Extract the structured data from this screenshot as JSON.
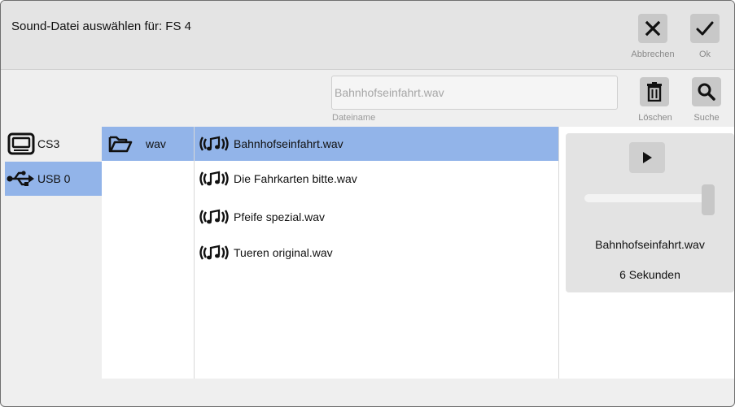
{
  "header": {
    "title": "Sound-Datei auswählen für: FS 4",
    "cancel": {
      "label": "Abbrechen",
      "icon": "close-icon"
    },
    "ok": {
      "label": "Ok",
      "icon": "check-icon"
    }
  },
  "toolbar": {
    "filename_value": "Bahnhofseinfahrt.wav",
    "filename_caption": "Dateiname",
    "delete": {
      "label": "Löschen",
      "icon": "trash-icon"
    },
    "search": {
      "label": "Suche",
      "icon": "magnifier-icon"
    }
  },
  "devices": [
    {
      "label": "CS3",
      "icon": "device-screen-icon",
      "selected": false
    },
    {
      "label": "USB 0",
      "icon": "usb-icon",
      "selected": true
    }
  ],
  "folders": [
    {
      "label": "wav",
      "icon": "folder-open-icon",
      "selected": true
    }
  ],
  "files": [
    {
      "label": "Bahnhofseinfahrt.wav",
      "icon": "sound-note-icon",
      "selected": true
    },
    {
      "label": "Die Fahrkarten bitte.wav",
      "icon": "sound-note-icon",
      "selected": false
    },
    {
      "label": "Pfeife spezial.wav",
      "icon": "sound-note-icon",
      "selected": false
    },
    {
      "label": "Tueren original.wav",
      "icon": "sound-note-icon",
      "selected": false
    }
  ],
  "preview": {
    "play_icon": "play-icon",
    "volume_level": 1.0,
    "filename": "Bahnhofseinfahrt.wav",
    "duration": "6 Sekunden"
  },
  "colors": {
    "selection": "#92b4e9",
    "header_bg": "#e4e4e4",
    "button_bg": "#c8c8c8"
  }
}
